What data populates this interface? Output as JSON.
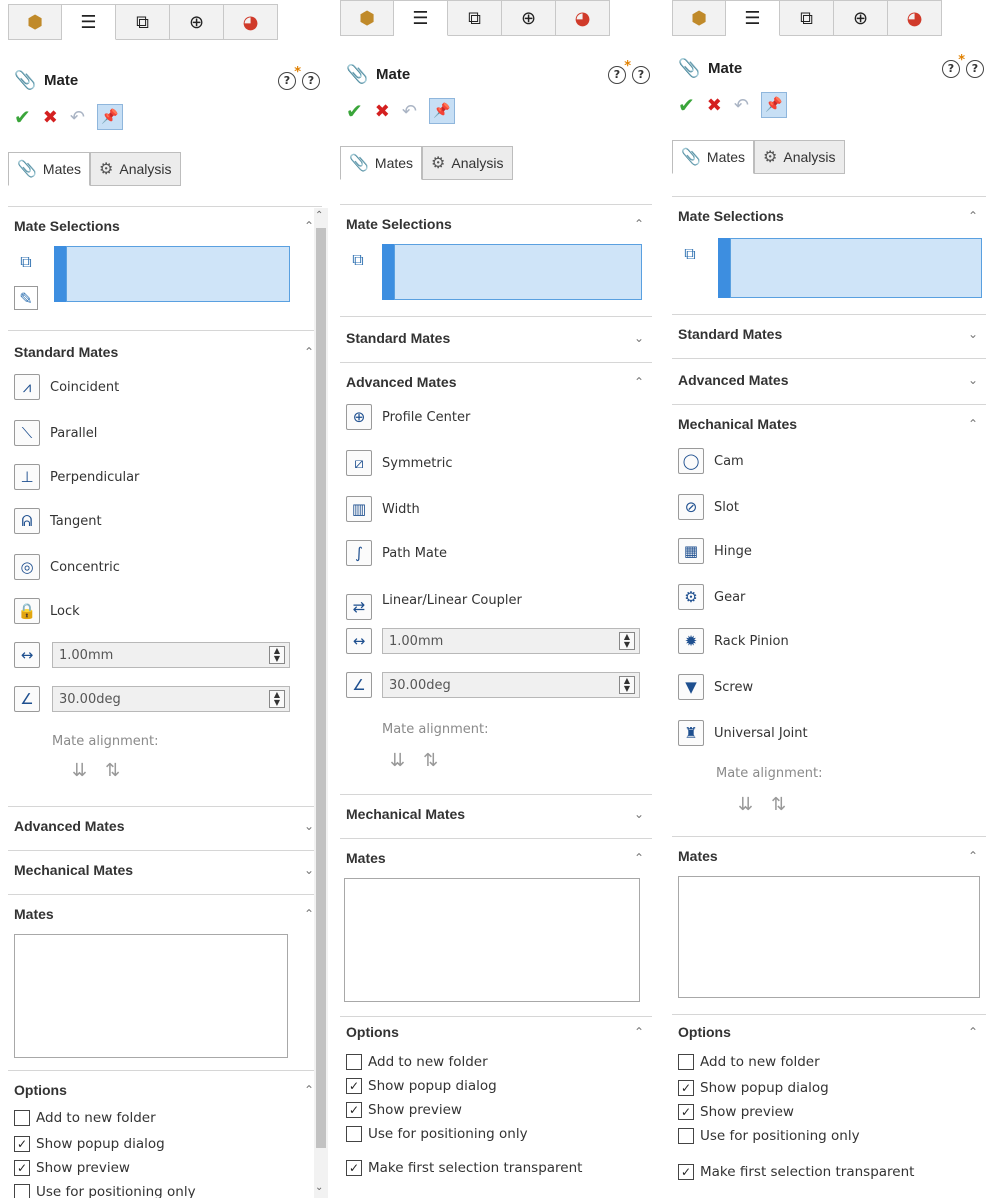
{
  "toolbar_tabs": [
    {
      "icon": "feature-manager-icon",
      "glyph": "⬢"
    },
    {
      "icon": "property-manager-icon",
      "glyph": "☰"
    },
    {
      "icon": "configuration-manager-icon",
      "glyph": "⧉"
    },
    {
      "icon": "dimxpert-manager-icon",
      "glyph": "⊕"
    },
    {
      "icon": "display-manager-icon",
      "glyph": "◕"
    }
  ],
  "header": {
    "title": "Mate"
  },
  "subtabs": {
    "mates": "Mates",
    "analysis": "Analysis"
  },
  "sections": {
    "mate_selections": "Mate Selections",
    "standard_mates": "Standard Mates",
    "advanced_mates": "Advanced Mates",
    "mechanical_mates": "Mechanical Mates",
    "mates": "Mates",
    "options": "Options"
  },
  "standard_mates": [
    "Coincident",
    "Parallel",
    "Perpendicular",
    "Tangent",
    "Concentric",
    "Lock"
  ],
  "advanced_mates": [
    "Profile Center",
    "Symmetric",
    "Width",
    "Path Mate",
    "Linear/Linear Coupler"
  ],
  "mechanical_mates": [
    "Cam",
    "Slot",
    "Hinge",
    "Gear",
    "Rack Pinion",
    "Screw",
    "Universal Joint"
  ],
  "fields": {
    "distance": "1.00mm",
    "angle": "30.00deg"
  },
  "mate_alignment_label": "Mate alignment:",
  "options": [
    {
      "label": "Add to new folder",
      "checked": false
    },
    {
      "label": "Show popup dialog",
      "checked": true
    },
    {
      "label": "Show preview",
      "checked": true
    },
    {
      "label": "Use for positioning only",
      "checked": false
    },
    {
      "label": "Make first selection transparent",
      "checked": true
    }
  ],
  "colors": {
    "accent": "#3d8ee0",
    "selection_fill": "#cfe4f8",
    "ok": "#3aa53a",
    "cancel": "#d42020"
  }
}
